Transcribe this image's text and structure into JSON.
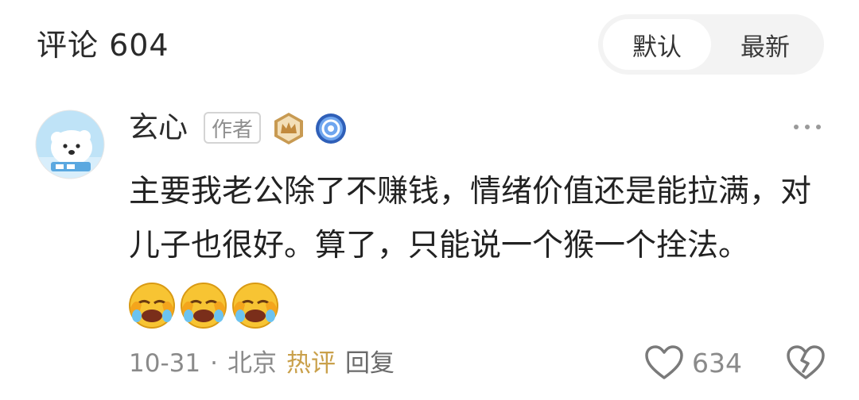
{
  "header": {
    "title": "评论 604",
    "sort_default": "默认",
    "sort_latest": "最新"
  },
  "comment": {
    "author": "玄心",
    "author_tag": "作者",
    "badges": [
      "crown-badge-icon",
      "ring-badge-icon"
    ],
    "text": "主要我老公除了不赚钱，情绪价值还是能拉满，对儿子也很好。算了，只能说一个猴一个拴法。",
    "emojis": [
      "laughing-crying-emoji",
      "laughing-crying-emoji",
      "laughing-crying-emoji"
    ],
    "date": "10-31",
    "separator": "·",
    "location": "北京",
    "hot_label": "热评",
    "reply_label": "回复",
    "likes": "634"
  },
  "colors": {
    "accent_gold": "#c9a04a",
    "avatar_bg": "#bfe3f7",
    "badge_blue": "#3a7bd5"
  }
}
